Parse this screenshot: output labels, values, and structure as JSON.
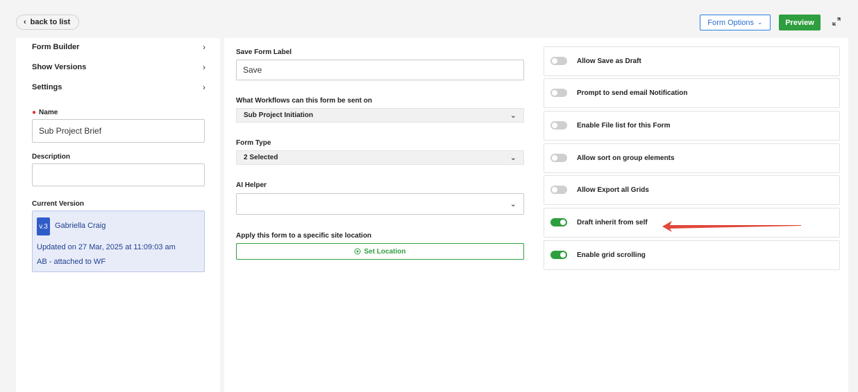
{
  "header": {
    "back_label": "back to list",
    "form_options_label": "Form Options",
    "preview_label": "Preview"
  },
  "sidebar": {
    "nav": [
      {
        "label": "Form Builder"
      },
      {
        "label": "Show Versions"
      },
      {
        "label": "Settings"
      }
    ],
    "name_label": "Name",
    "name_value": "Sub Project Brief",
    "description_label": "Description",
    "description_value": "",
    "current_version_label": "Current Version",
    "version": {
      "badge": "v.3",
      "user": "Gabriella Craig",
      "updated": "Updated on 27 Mar, 2025 at 11:09:03 am",
      "note": "AB - attached to WF"
    }
  },
  "main": {
    "save_label_title": "Save Form Label",
    "save_label_value": "Save",
    "workflows_title": "What Workflows can this form be sent on",
    "workflows_value": "Sub Project Initiation",
    "form_type_title": "Form Type",
    "form_type_value": "2 Selected",
    "ai_helper_title": "AI Helper",
    "ai_helper_value": "",
    "location_title": "Apply this form to a specific site location",
    "set_location_label": "Set Location"
  },
  "toggles": [
    {
      "label": "Allow Save as Draft",
      "on": false
    },
    {
      "label": "Prompt to send email Notification",
      "on": false
    },
    {
      "label": "Enable File list for this Form",
      "on": false
    },
    {
      "label": "Allow sort on group elements",
      "on": false
    },
    {
      "label": "Allow Export all Grids",
      "on": false
    },
    {
      "label": "Draft inherit from self",
      "on": true
    },
    {
      "label": "Enable grid scrolling",
      "on": true
    }
  ],
  "colors": {
    "accent_green": "#2e9e3f",
    "accent_blue": "#2a7de1",
    "annotation_red": "#e0483a"
  }
}
